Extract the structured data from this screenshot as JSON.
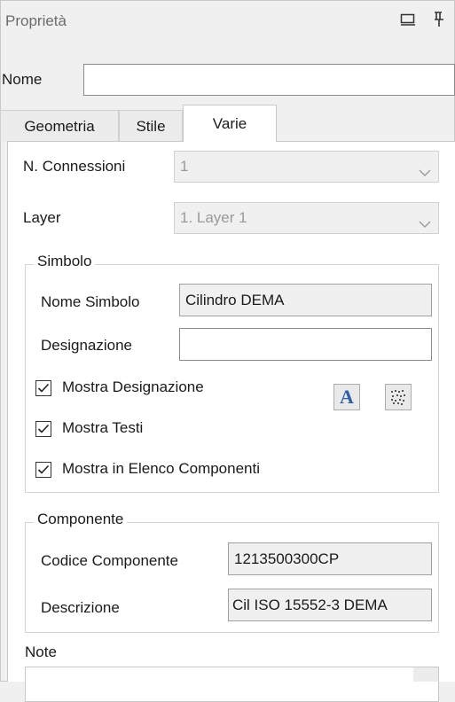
{
  "panel": {
    "title": "Proprietà",
    "icons": {
      "float": "window-restore-icon",
      "pin": "pin-icon"
    }
  },
  "name_field": {
    "label": "Nome",
    "value": ""
  },
  "tabs": [
    {
      "label": "Geometria",
      "active": false
    },
    {
      "label": "Stile",
      "active": false
    },
    {
      "label": "Varie",
      "active": true
    }
  ],
  "varie": {
    "connessioni": {
      "label": "N. Connessioni",
      "value": "1"
    },
    "layer": {
      "label": "Layer",
      "value": "1. Layer 1"
    },
    "simbolo": {
      "title": "Simbolo",
      "nome": {
        "label": "Nome Simbolo",
        "value": "Cilindro DEMA"
      },
      "designazione": {
        "label": "Designazione",
        "value": ""
      },
      "checks": [
        {
          "label": "Mostra Designazione",
          "checked": true
        },
        {
          "label": "Mostra Testi",
          "checked": true
        },
        {
          "label": "Mostra in Elenco Componenti",
          "checked": true
        }
      ],
      "buttons": {
        "font": "A",
        "font_icon": "font-icon",
        "pattern_icon": "pattern-icon"
      }
    },
    "componente": {
      "title": "Componente",
      "codice": {
        "label": "Codice Componente",
        "value": "1213500300CP"
      },
      "descrizione": {
        "label": "Descrizione",
        "value": "Cil ISO 15552-3 DEMA"
      }
    },
    "note": {
      "label": "Note",
      "value": ""
    }
  },
  "colors": {
    "background": "#f0f0f0",
    "panel_white": "#ffffff",
    "title_grey": "#6b6b6b",
    "font_button_blue": "#2e5fa8"
  }
}
